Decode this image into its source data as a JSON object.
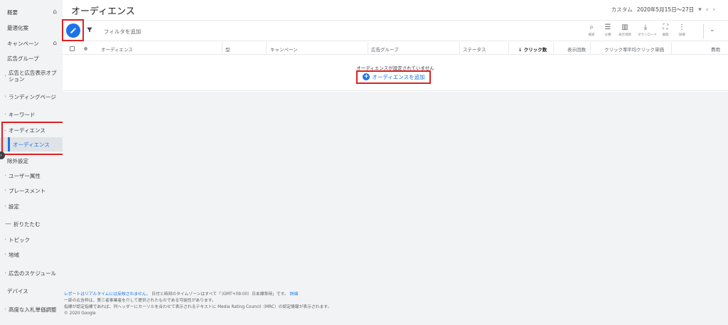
{
  "sidebar": {
    "items": [
      {
        "label": "概要",
        "home": true
      },
      {
        "label": "最適化案"
      },
      {
        "label": "キャンペーン",
        "home": true
      },
      {
        "label": "広告グループ"
      },
      {
        "label": "広告と広告表示オプション",
        "arrow": true
      },
      {
        "label": "ランディングページ",
        "arrow": true
      },
      {
        "label": "キーワード",
        "arrow": true
      },
      {
        "label": "オーディエンス",
        "arrow": true,
        "expanded": true
      },
      {
        "label": "オーディエンス",
        "sub": true,
        "active": true
      },
      {
        "label": "除外設定"
      },
      {
        "label": "ユーザー属性",
        "arrow": true
      },
      {
        "label": "プレースメント",
        "arrow": true
      },
      {
        "label": "設定",
        "arrow": true
      },
      {
        "label": "折りたたむ",
        "collapse": true
      },
      {
        "label": "トピック",
        "arrow": true
      },
      {
        "label": "地域",
        "arrow": true
      },
      {
        "label": "広告のスケジュール",
        "arrow": true
      },
      {
        "label": "デバイス"
      },
      {
        "label": "高度な入札単価調整",
        "arrow": true
      }
    ]
  },
  "header": {
    "title": "オーディエンス",
    "date_prefix": "カスタム",
    "date_range": "2020年5月15日〜27日"
  },
  "toolbar": {
    "filter_placeholder": "フィルタを追加",
    "tools": [
      {
        "icon": "search-icon",
        "label": "検索"
      },
      {
        "icon": "segment-icon",
        "label": "分類"
      },
      {
        "icon": "columns-icon",
        "label": "表示項目"
      },
      {
        "icon": "download-icon",
        "label": "ダウンロード"
      },
      {
        "icon": "fullscreen-icon",
        "label": "展開"
      },
      {
        "icon": "more-icon",
        "label": "詳細"
      }
    ]
  },
  "table": {
    "columns": [
      {
        "label": "オーディエンス"
      },
      {
        "label": "型"
      },
      {
        "label": "キャンペーン"
      },
      {
        "label": "広告グループ"
      },
      {
        "label": "ステータス"
      },
      {
        "label": "↓ クリック数",
        "sorted": true
      },
      {
        "label": "表示回数"
      },
      {
        "label": "クリック率"
      },
      {
        "label": "平均クリック単価"
      },
      {
        "label": "費用"
      }
    ],
    "empty_message": "オーディエンスが設定されていません",
    "add_label": "オーディエンスを追加"
  },
  "footer": {
    "line1_link": "レポートはリアルタイムには反映されません。",
    "line1_text": " 日付と時刻のタイムゾーンはすべて「（GMT+09:00）日本標準時」です。",
    "line1_detail": "詳細",
    "line2": "一部の広告枠は、第三者事業者を介して提供されたものである可能性があります。",
    "line3": "指標が認定指標であれば、列ヘッダーにカーソルを合わせて表示されるテキストに Media Rating Council（MRC）の認定情報が表示されます。",
    "copyright": "© 2020 Google"
  },
  "colors": {
    "accent": "#1a73e8",
    "highlight": "#e02020",
    "sidebar_bg": "#f1f3f4"
  }
}
